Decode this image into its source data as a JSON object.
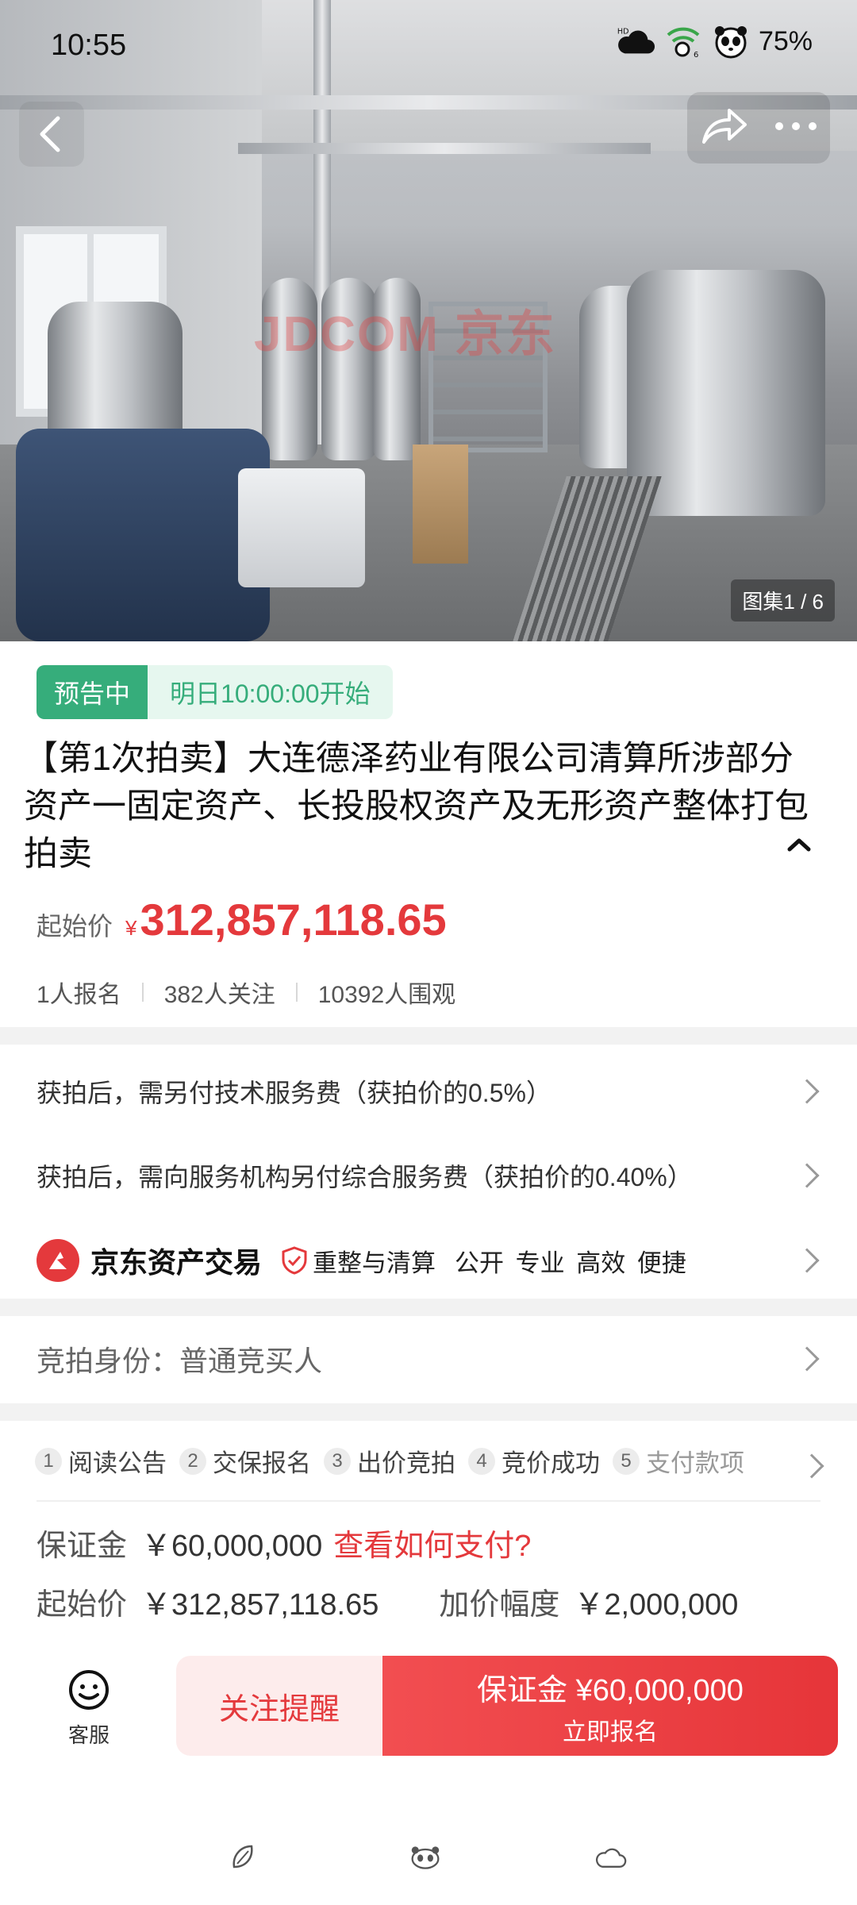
{
  "status_bar": {
    "time": "10:55",
    "battery": "75%",
    "hd_label": "HD",
    "signal_sub": "6"
  },
  "hero": {
    "watermark": "JDCOM 京东",
    "gallery_counter": "图集1 / 6"
  },
  "auction": {
    "status_badge": "预告中",
    "start_time": "明日10:00:00开始",
    "title": "【第1次拍卖】大连德泽药业有限公司清算所涉部分资产一固定资产、长投股权资产及无形资产整体打包拍卖",
    "price_label": "起始价",
    "currency": "¥",
    "starting_price": "312,857,118.65",
    "stats": {
      "registered": "1人报名",
      "followers": "382人关注",
      "viewers": "10392人围观"
    }
  },
  "fees": {
    "tech_fee": "获拍后，需另付技术服务费（获拍价的0.5%）",
    "service_fee": "获拍后，需向服务机构另付综合服务费（获拍价的0.40%）"
  },
  "brand": {
    "name": "京东资产交易",
    "tag": "重整与清算",
    "slogan": "公开 专业 高效 便捷"
  },
  "identity": {
    "text": "竞拍身份：普通竞买人"
  },
  "process": {
    "steps": [
      {
        "num": "1",
        "label": "阅读公告"
      },
      {
        "num": "2",
        "label": "交保报名"
      },
      {
        "num": "3",
        "label": "出价竞拍"
      },
      {
        "num": "4",
        "label": "竞价成功"
      },
      {
        "num": "5",
        "label": "支付款项"
      }
    ],
    "deposit_label": "保证金",
    "deposit_value": "￥60,000,000",
    "deposit_link": "查看如何支付?",
    "start_label": "起始价",
    "start_value": "￥312,857,118.65",
    "increment_label": "加价幅度",
    "increment_value": "￥2,000,000"
  },
  "bottom_bar": {
    "service_label": "客服",
    "follow_button": "关注提醒",
    "register_line1": "保证金 ¥60,000,000",
    "register_line2": "立即报名"
  },
  "colors": {
    "accent_red": "#e4393c",
    "status_green": "#36ad7b"
  }
}
